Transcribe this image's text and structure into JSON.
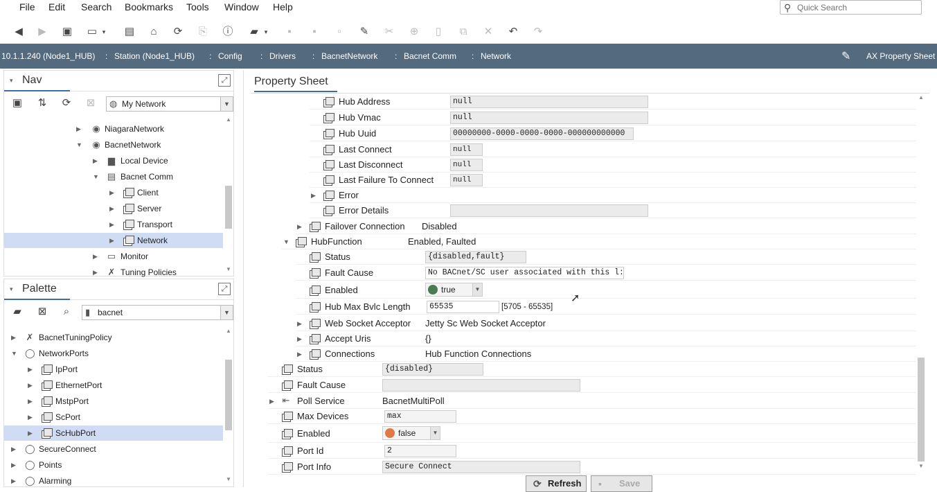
{
  "menu": [
    "File",
    "Edit",
    "Search",
    "Bookmarks",
    "Tools",
    "Window",
    "Help"
  ],
  "search": {
    "placeholder": "Quick Search"
  },
  "breadcrumb": [
    "10.1.1.240 (Node1_HUB)",
    "Station (Node1_HUB)",
    "Config",
    "Drivers",
    "BacnetNetwork",
    "Bacnet Comm",
    "Network"
  ],
  "view_selector": "AX Property Sheet",
  "nav": {
    "title": "Nav",
    "network_select": "My Network",
    "items": [
      "NiagaraNetwork",
      "BacnetNetwork",
      "Local Device",
      "Bacnet Comm",
      "Client",
      "Server",
      "Transport",
      "Network",
      "Monitor",
      "Tuning Policies"
    ]
  },
  "palette": {
    "title": "Palette",
    "module_select": "bacnet",
    "items": [
      "BacnetTuningPolicy",
      "NetworkPorts",
      "IpPort",
      "EthernetPort",
      "MstpPort",
      "ScPort",
      "ScHubPort",
      "SecureConnect",
      "Points",
      "Alarming"
    ]
  },
  "main": {
    "tab": "Property Sheet",
    "props": [
      {
        "label": "Hub Address",
        "value": "null"
      },
      {
        "label": "Hub Vmac",
        "value": "null"
      },
      {
        "label": "Hub Uuid",
        "value": "00000000-0000-0000-0000-000000000000"
      },
      {
        "label": "Last Connect",
        "value": "null"
      },
      {
        "label": "Last Disconnect",
        "value": "null"
      },
      {
        "label": "Last Failure To Connect",
        "value": "null"
      },
      {
        "label": "Error",
        "value": ""
      },
      {
        "label": "Error Details",
        "value": ""
      },
      {
        "label": "Failover Connection",
        "value": "Disabled"
      },
      {
        "label": "HubFunction",
        "value": "Enabled, Faulted"
      },
      {
        "label": "Status",
        "value": "{disabled,fault}"
      },
      {
        "label": "Fault Cause",
        "value": "No BACnet/SC user associated with this l:"
      },
      {
        "label": "Enabled",
        "value": "true"
      },
      {
        "label": "Hub Max Bvlc Length",
        "value": "65535",
        "range": "[5705 - 65535]"
      },
      {
        "label": "Web Socket Acceptor",
        "value": "Jetty Sc Web Socket Acceptor"
      },
      {
        "label": "Accept Uris",
        "value": "{}"
      },
      {
        "label": "Connections",
        "value": "Hub Function Connections"
      },
      {
        "label": "Status",
        "value": "{disabled}"
      },
      {
        "label": "Fault Cause",
        "value": ""
      },
      {
        "label": "Poll Service",
        "value": "BacnetMultiPoll"
      },
      {
        "label": "Max Devices",
        "value": "max"
      },
      {
        "label": "Enabled",
        "value": "false"
      },
      {
        "label": "Port Id",
        "value": "2"
      },
      {
        "label": "Port Info",
        "value": "Secure Connect"
      }
    ],
    "buttons": {
      "refresh": "Refresh",
      "save": "Save"
    }
  },
  "colors": {
    "locbar": "#536a7f",
    "selected": "#cfdcf3",
    "true_dot": "#4a7a52",
    "false_dot": "#e07a45"
  }
}
